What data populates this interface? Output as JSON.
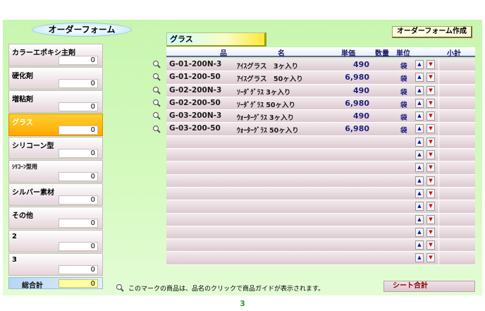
{
  "form_title": "オーダーフォーム",
  "create_button": "オーダーフォーム作成",
  "category_heading": "グラス",
  "columns": {
    "name_hin": "品",
    "name_mei": "名",
    "price": "単価",
    "qty": "数量",
    "unit": "単位",
    "subtotal": "小計"
  },
  "categories": [
    {
      "label": "カラーエポキシ主剤",
      "value": "0",
      "selected": false
    },
    {
      "label": "硬化剤",
      "value": "0",
      "selected": false
    },
    {
      "label": "増粘剤",
      "value": "0",
      "selected": false
    },
    {
      "label": "グラス",
      "value": "0",
      "selected": true
    },
    {
      "label": "シリコーン型",
      "value": "0",
      "selected": false
    },
    {
      "label": "ｼﾘｺｰﾝ型用",
      "value": "0",
      "selected": false
    },
    {
      "label": "シルバー素材",
      "value": "0",
      "selected": false
    },
    {
      "label": "その他",
      "value": "0",
      "selected": false
    },
    {
      "label": "2",
      "value": "0",
      "selected": false
    },
    {
      "label": "3",
      "value": "0",
      "selected": false
    }
  ],
  "total": {
    "label": "総合計",
    "value": "0"
  },
  "products": [
    {
      "code": "G-01-200N-3",
      "name": "ｱｲｽグラス　3ヶ入り",
      "price": "490",
      "unit": "袋"
    },
    {
      "code": "G-01-200-50",
      "name": "ｱｲｽグラス　50ヶ入り",
      "price": "6,980",
      "unit": "袋"
    },
    {
      "code": "G-02-200N-3",
      "name": "ｿｰﾀﾞｸﾞﾗｽ 3ヶ入り",
      "price": "490",
      "unit": "袋"
    },
    {
      "code": "G-02-200-50",
      "name": "ｿｰﾀﾞｸﾞﾗｽ 50ヶ入り",
      "price": "6,980",
      "unit": "袋"
    },
    {
      "code": "G-03-200N-3",
      "name": "ｳｫｰﾀｰｸﾞﾗｽ 3ヶ入り",
      "price": "490",
      "unit": "袋"
    },
    {
      "code": "G-03-200-50",
      "name": "ｳｫｰﾀｰｸﾞﾗｽ 50ヶ入り",
      "price": "6,980",
      "unit": "袋"
    }
  ],
  "empty_row_count": 10,
  "footnote": "このマークの商品は、品名のクリックで商品ガイドが表示されます。",
  "sheet_total_label": "シート合計",
  "page_number": "3",
  "icons": {
    "search": "magnifier-icon",
    "up": "up-arrow-icon",
    "down": "down-arrow-icon"
  },
  "colors": {
    "selected": "#ffb000",
    "background": "#d0f8b8",
    "row": "#e4d4d9"
  }
}
